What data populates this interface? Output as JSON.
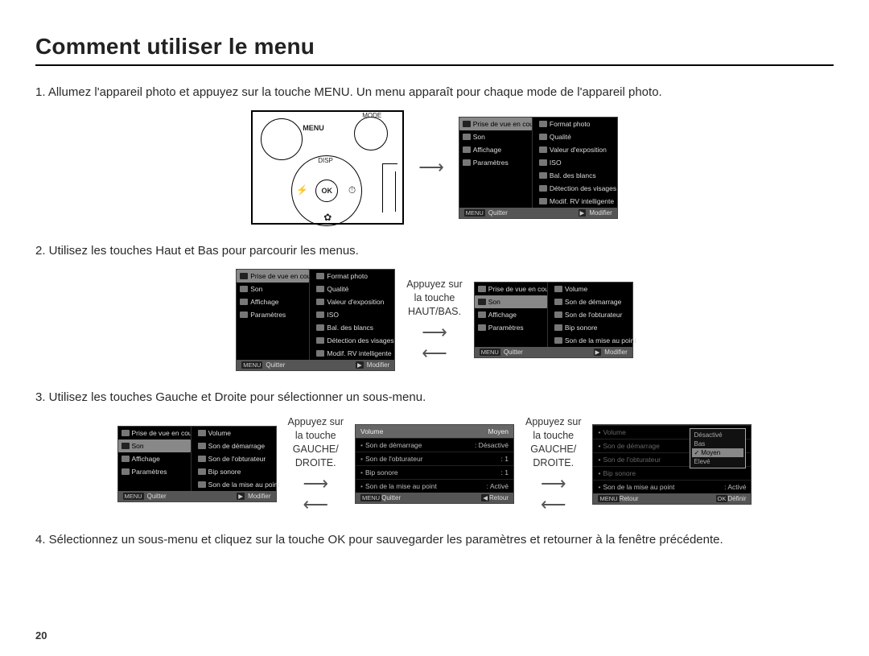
{
  "title": "Comment utiliser le menu",
  "page_number": "20",
  "steps": {
    "s1": "1. Allumez l'appareil photo et appuyez sur la touche MENU. Un menu apparaît pour chaque mode de l'appareil photo.",
    "s2": "2. Utilisez les touches Haut et Bas pour parcourir les menus.",
    "s3": "3. Utilisez les touches Gauche et Droite pour sélectionner un sous-menu.",
    "s4": "4. Sélectionnez un sous-menu et cliquez sur la touche OK pour sauvegarder les paramètres et retourner à la fenêtre précédente."
  },
  "camera": {
    "menu": "MENU",
    "mode": "MODE",
    "disp": "DISP",
    "ok": "OK",
    "flash": "⚡",
    "timer": "⏱",
    "macro": "✿"
  },
  "hints": {
    "updown": "Appuyez sur\nla touche\nHAUT/BAS.",
    "leftright": "Appuyez sur\nla touche\nGAUCHE/\nDROITE."
  },
  "menuA": {
    "left": [
      {
        "label": "Prise de vue en cours",
        "sel": true
      },
      {
        "label": "Son"
      },
      {
        "label": "Affichage"
      },
      {
        "label": "Paramètres"
      }
    ],
    "right": [
      {
        "label": "Format photo"
      },
      {
        "label": "Qualité"
      },
      {
        "label": "Valeur d'exposition"
      },
      {
        "label": "ISO"
      },
      {
        "label": "Bal. des blancs"
      },
      {
        "label": "Détection des visages"
      },
      {
        "label": "Modif. RV intelligente"
      }
    ],
    "foot_l": "Quitter",
    "foot_r": "Modifier",
    "btn_l": "MENU",
    "btn_r": "▶"
  },
  "menuB": {
    "left": [
      {
        "label": "Prise de vue en cours"
      },
      {
        "label": "Son",
        "sel": true
      },
      {
        "label": "Affichage"
      },
      {
        "label": "Paramètres"
      }
    ],
    "right": [
      {
        "label": "Volume"
      },
      {
        "label": "Son de démarrage"
      },
      {
        "label": "Son de l'obturateur"
      },
      {
        "label": "Bip sonore"
      },
      {
        "label": "Son de la mise au point"
      }
    ],
    "foot_l": "Quitter",
    "foot_r": "Modifier",
    "btn_l": "MENU",
    "btn_r": "▶"
  },
  "menuC": {
    "header_l": "Volume",
    "header_r": "Moyen",
    "lines": [
      {
        "l": "Son de démarrage",
        "r": "Désactivé"
      },
      {
        "l": "Son de l'obturateur",
        "r": "1"
      },
      {
        "l": "Bip sonore",
        "r": "1"
      },
      {
        "l": "Son de la mise au point",
        "r": "Activé"
      }
    ],
    "foot_l": "Quitter",
    "foot_r": "Retour",
    "btn_l": "MENU",
    "btn_r": "◀"
  },
  "menuD": {
    "lines": [
      {
        "l": "Volume"
      },
      {
        "l": "Son de démarrage"
      },
      {
        "l": "Son de l'obturateur"
      },
      {
        "l": "Bip sonore"
      },
      {
        "l": "Son de la mise au point",
        "r": "Activé"
      }
    ],
    "popup": [
      "Désactivé",
      "Bas",
      "Moyen",
      "Elevé"
    ],
    "popup_sel": "Moyen",
    "foot_l": "Retour",
    "foot_r": "Définir",
    "btn_l": "MENU",
    "btn_r": "OK"
  }
}
